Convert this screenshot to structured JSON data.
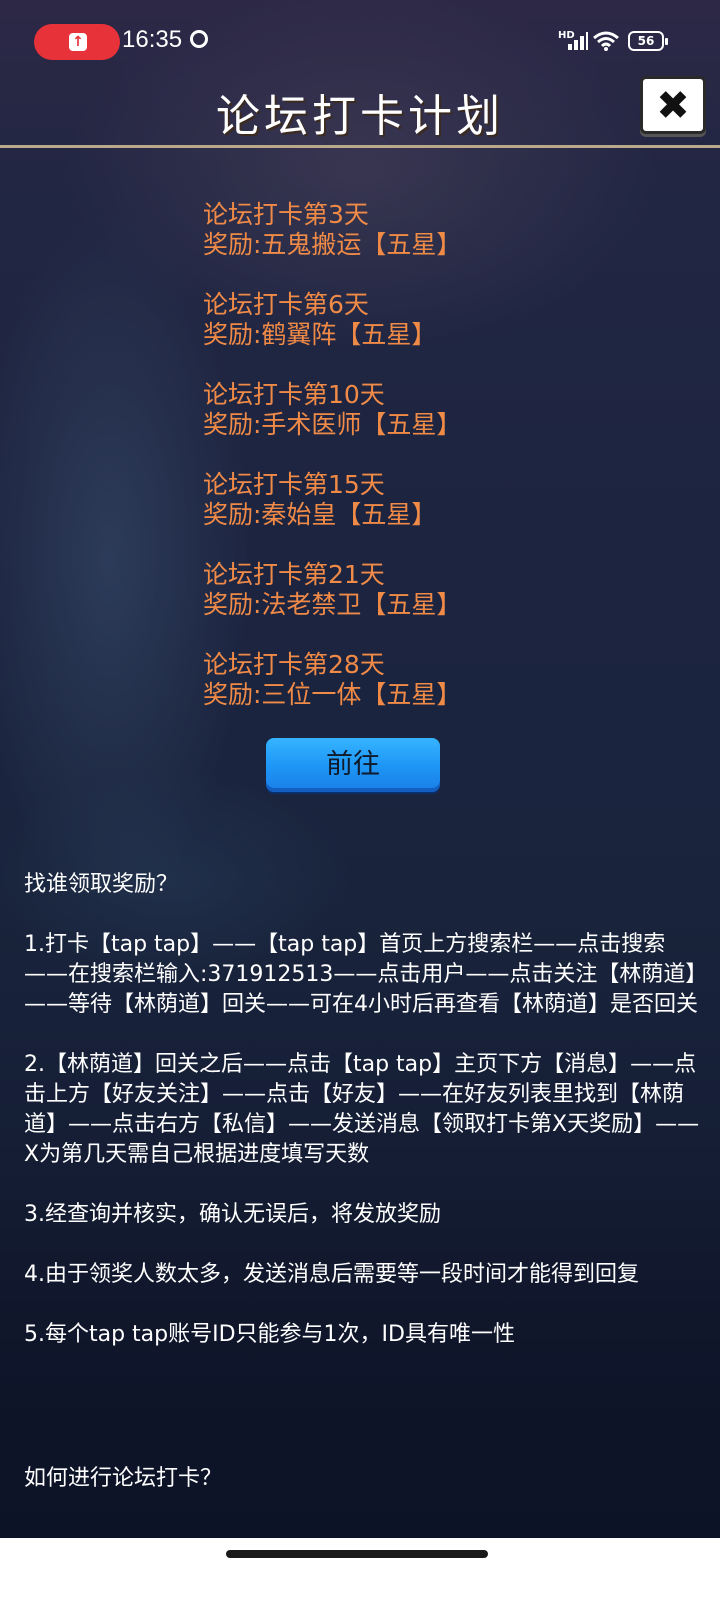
{
  "status_bar": {
    "time": "16:35",
    "network_label": "HD",
    "battery": "56"
  },
  "header": {
    "title": "论坛打卡计划",
    "close_icon": "close-x-icon"
  },
  "rewards": [
    {
      "day": "论坛打卡第3天",
      "reward": "奖励:五鬼搬运【五星】"
    },
    {
      "day": "论坛打卡第6天",
      "reward": "奖励:鹤翼阵【五星】"
    },
    {
      "day": "论坛打卡第10天",
      "reward": "奖励:手术医师【五星】"
    },
    {
      "day": "论坛打卡第15天",
      "reward": "奖励:秦始皇【五星】"
    },
    {
      "day": "论坛打卡第21天",
      "reward": "奖励:法老禁卫【五星】"
    },
    {
      "day": "论坛打卡第28天",
      "reward": "奖励:三位一体【五星】"
    }
  ],
  "go_button": "前往",
  "instructions": {
    "heading": "找谁领取奖励？",
    "steps": [
      "1.打卡【tap tap】——【tap tap】首页上方搜索栏——点击搜索——在搜索栏输入:371912513——点击用户——点击关注【林荫道】——等待【林荫道】回关——可在4小时后再查看【林荫道】是否回关",
      "2.【林荫道】回关之后——点击【tap tap】主页下方【消息】——点击上方【好友关注】——点击【好友】——在好友列表里找到【林荫道】——点击右方【私信】——发送消息【领取打卡第X天奖励】——X为第几天需自己根据进度填写天数",
      "3.经查询并核实，确认无误后，将发放奖励",
      "4.由于领奖人数太多，发送消息后需要等一段时间才能得到回复",
      "5.每个tap tap账号ID只能参与1次，ID具有唯一性"
    ]
  },
  "footer_question": "如何进行论坛打卡？"
}
